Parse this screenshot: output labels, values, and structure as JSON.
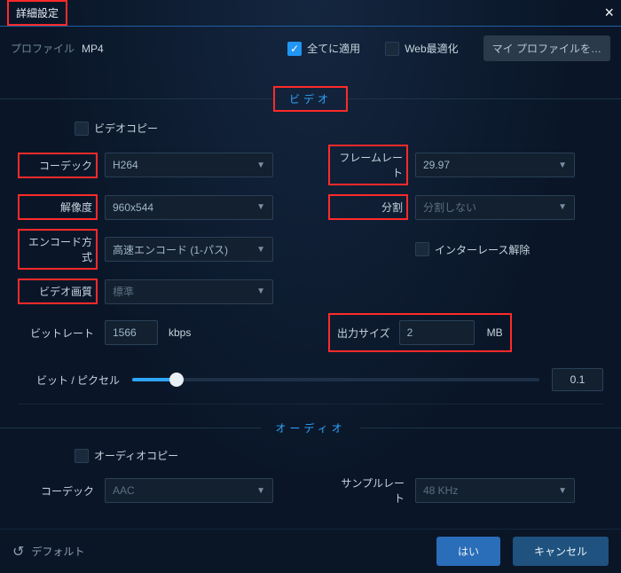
{
  "header": {
    "title": "詳細設定",
    "close_glyph": "×"
  },
  "subheader": {
    "profile_label": "プロファイル",
    "profile_value": "MP4",
    "apply_all_label": "全てに適用",
    "web_optimize_label": "Web最適化",
    "my_profile_label": "マイ プロファイルを…"
  },
  "video": {
    "section_title": "ビデオ",
    "video_copy_label": "ビデオコピー",
    "codec_label": "コーデック",
    "codec_value": "H264",
    "resolution_label": "解像度",
    "resolution_value": "960x544",
    "encode_label": "エンコード方式",
    "encode_value": "高速エンコード (1-パス)",
    "quality_label": "ビデオ画質",
    "quality_value": "標準",
    "bitrate_label": "ビットレート",
    "bitrate_value": "1566",
    "bitrate_unit": "kbps",
    "framerate_label": "フレームレート",
    "framerate_value": "29.97",
    "split_label": "分割",
    "split_value": "分割しない",
    "deinterlace_label": "インターレース解除",
    "output_label": "出力サイズ",
    "output_value": "2",
    "output_unit": "MB",
    "bpp_label": "ビット / ピクセル",
    "bpp_value": "0.1"
  },
  "audio": {
    "section_title": "オーディオ",
    "audio_copy_label": "オーディオコピー",
    "codec_label": "コーデック",
    "codec_value": "AAC",
    "samplerate_label": "サンプルレート",
    "samplerate_value": "48 KHz"
  },
  "footer": {
    "reset_label": "デフォルト",
    "ok_label": "はい",
    "cancel_label": "キャンセル"
  }
}
